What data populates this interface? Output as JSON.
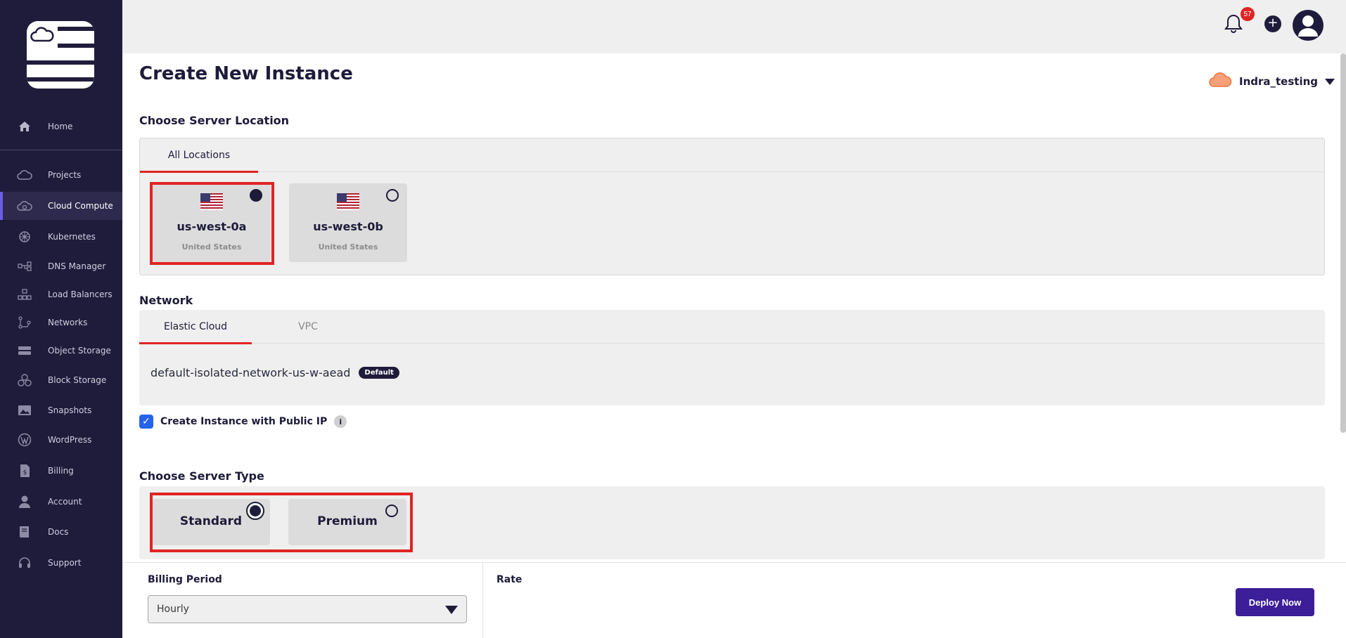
{
  "sidebar": {
    "items": [
      {
        "label": "Home",
        "icon": "home-icon"
      },
      {
        "label": "Projects",
        "icon": "cloud-icon"
      },
      {
        "label": "Cloud Compute",
        "icon": "cloud-compute-icon",
        "active": true
      },
      {
        "label": "Kubernetes",
        "icon": "kubernetes-icon"
      },
      {
        "label": "DNS Manager",
        "icon": "dns-icon"
      },
      {
        "label": "Load Balancers",
        "icon": "load-balancer-icon"
      },
      {
        "label": "Networks",
        "icon": "network-icon"
      },
      {
        "label": "Object Storage",
        "icon": "object-storage-icon"
      },
      {
        "label": "Block Storage",
        "icon": "block-storage-icon"
      },
      {
        "label": "Snapshots",
        "icon": "image-icon"
      },
      {
        "label": "WordPress",
        "icon": "wordpress-icon"
      },
      {
        "label": "Billing",
        "icon": "billing-icon"
      },
      {
        "label": "Account",
        "icon": "user-icon"
      },
      {
        "label": "Docs",
        "icon": "book-icon"
      },
      {
        "label": "Support",
        "icon": "headset-icon"
      }
    ]
  },
  "topbar": {
    "notification_count": "57"
  },
  "page": {
    "title": "Create New Instance",
    "account": "Indra_testing"
  },
  "location": {
    "section_title": "Choose Server Location",
    "tab": "All Locations",
    "options": [
      {
        "name": "us-west-0a",
        "country": "United States",
        "selected": true
      },
      {
        "name": "us-west-0b",
        "country": "United States",
        "selected": false
      }
    ]
  },
  "network": {
    "section_title": "Network",
    "tabs": [
      "Elastic Cloud",
      "VPC"
    ],
    "network_name": "default-isolated-network-us-w-aead",
    "badge": "Default"
  },
  "public_ip": {
    "label": "Create Instance with Public IP",
    "checked": true,
    "info": "i"
  },
  "server_type": {
    "section_title": "Choose Server Type",
    "options": [
      {
        "name": "Standard",
        "selected": true
      },
      {
        "name": "Premium",
        "selected": false
      }
    ]
  },
  "bottom": {
    "billing_label": "Billing Period",
    "billing_value": "Hourly",
    "rate_label": "Rate",
    "deploy_label": "Deploy Now"
  },
  "colors": {
    "sidebar_bg": "#1f1c3b",
    "accent_red": "#e02424",
    "deploy_button": "#3b1e98",
    "checkbox": "#2563eb"
  }
}
